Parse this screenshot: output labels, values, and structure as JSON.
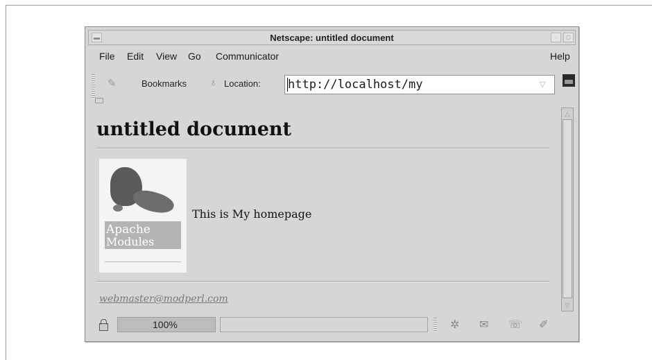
{
  "window": {
    "title": "Netscape: untitled document"
  },
  "menu": {
    "file": "File",
    "edit": "Edit",
    "view": "View",
    "go": "Go",
    "communicator": "Communicator",
    "help": "Help"
  },
  "toolbar": {
    "bookmarks_label": "Bookmarks",
    "location_label": "Location:",
    "location_value": "http://localhost/my"
  },
  "page": {
    "heading": "untitled document",
    "body_text": "This is My homepage",
    "mail_link": "webmaster@modperl.com",
    "book_title_line1": "Apache",
    "book_title_line2": "Modules"
  },
  "status": {
    "progress_text": "100%",
    "progress": 1.0
  },
  "icons": [
    "minimize-icon",
    "maximize-icon",
    "bookmarks-icon",
    "location-icon",
    "netscape-logo-icon",
    "lock-icon",
    "navigator-icon",
    "mail-icon",
    "discussion-icon",
    "composer-icon"
  ]
}
